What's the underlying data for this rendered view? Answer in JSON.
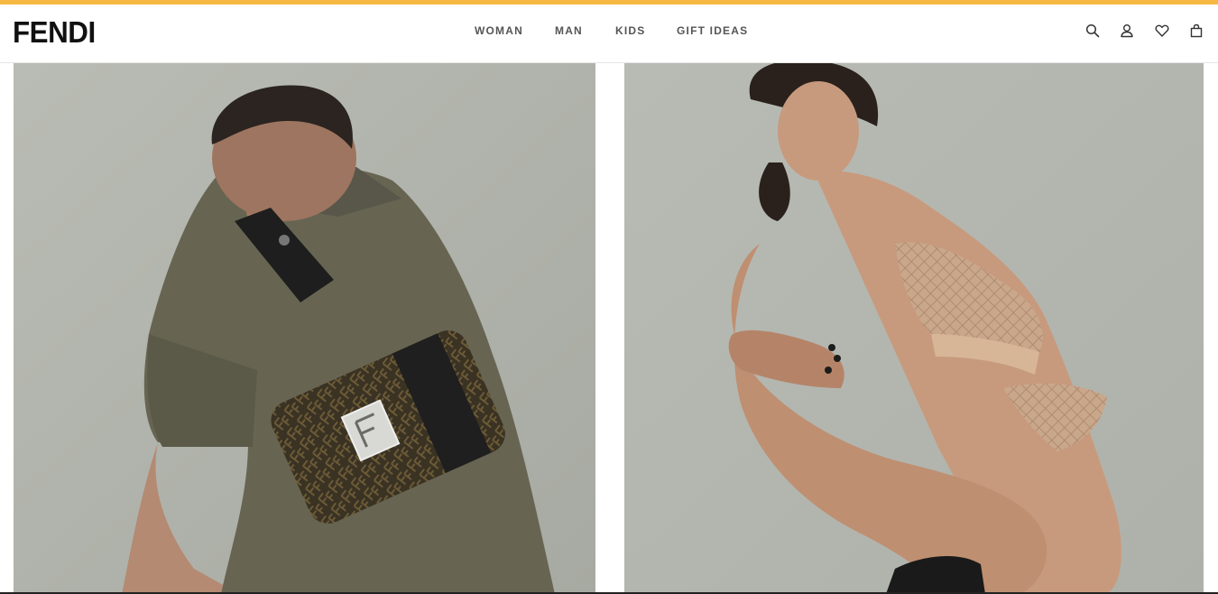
{
  "colors": {
    "accent_bar": "#f7b843",
    "text_dark": "#111111",
    "nav_text": "#555555"
  },
  "header": {
    "logo": "FENDI",
    "nav": [
      {
        "label": "WOMAN"
      },
      {
        "label": "MAN"
      },
      {
        "label": "KIDS"
      },
      {
        "label": "GIFT IDEAS"
      }
    ],
    "icons": [
      "search-icon",
      "account-icon",
      "wishlist-heart-icon",
      "shopping-bag-icon"
    ]
  },
  "main": {
    "panels": [
      {
        "image": "man-with-ff-belt-bag"
      },
      {
        "image": "woman-in-mesh-lingerie"
      }
    ]
  }
}
